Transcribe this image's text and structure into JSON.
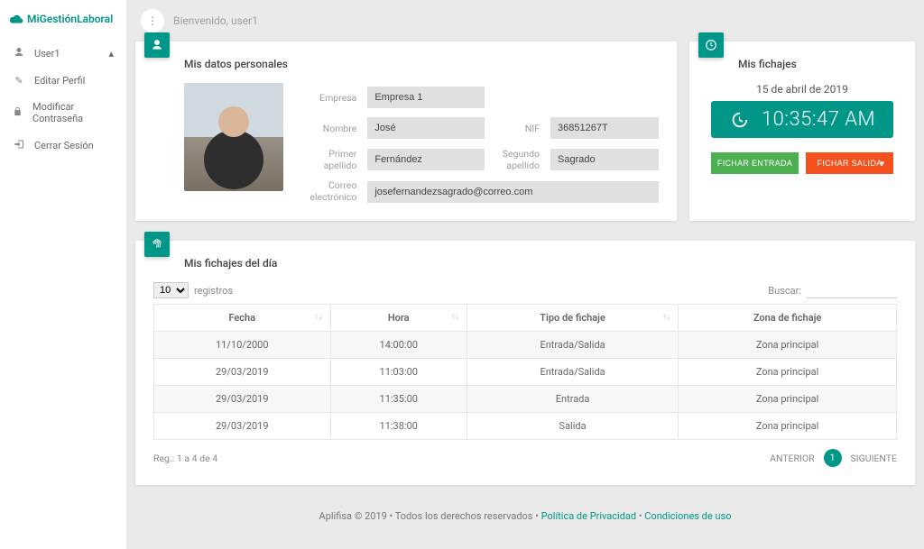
{
  "brand": "MiGestiónLaboral",
  "topbar": {
    "welcome": "Bienvenido, user1"
  },
  "sidebar": {
    "user": "User1",
    "items": [
      {
        "icon": "pencil-icon",
        "label": "Editar Perfil"
      },
      {
        "icon": "lock-icon",
        "label": "Modificar Contraseña"
      },
      {
        "icon": "logout-icon",
        "label": "Cerrar Sesión"
      }
    ]
  },
  "personal": {
    "title": "Mis datos personales",
    "labels": {
      "empresa": "Empresa",
      "nombre": "Nombre",
      "nif": "NIF",
      "apellido1": "Primer apellido",
      "apellido2": "Segundo apellido",
      "correo": "Correo electrónico"
    },
    "values": {
      "empresa": "Empresa 1",
      "nombre": "José",
      "nif": "36851267T",
      "apellido1": "Fernández",
      "apellido2": "Sagrado",
      "correo": "josefernandezsagrado@correo.com"
    }
  },
  "clock": {
    "title": "Mis fichajes",
    "date": "15 de abril de 2019",
    "time": "10:35:47 AM",
    "btn_in": "FICHAR ENTRADA",
    "btn_out": "FICHAR SALIDA"
  },
  "daylog": {
    "title": "Mis fichajes del día",
    "page_size": "10",
    "page_size_label": "registros",
    "search_label": "Buscar:",
    "columns": [
      "Fecha",
      "Hora",
      "Tipo de fichaje",
      "Zona de fichaje"
    ],
    "rows": [
      {
        "fecha": "11/10/2000",
        "hora": "14:00:00",
        "tipo": "Entrada/Salida",
        "zona": "Zona principal"
      },
      {
        "fecha": "29/03/2019",
        "hora": "11:03:00",
        "tipo": "Entrada/Salida",
        "zona": "Zona principal"
      },
      {
        "fecha": "29/03/2019",
        "hora": "11:35:00",
        "tipo": "Entrada",
        "zona": "Zona principal"
      },
      {
        "fecha": "29/03/2019",
        "hora": "11:38:00",
        "tipo": "Salida",
        "zona": "Zona principal"
      }
    ],
    "summary": "Reg.: 1 a 4 de 4",
    "prev": "ANTERIOR",
    "next": "SIGUIENTE",
    "page": "1"
  },
  "footer": {
    "text1": "Aplifisa © 2019 • Todos los derechos reservados • ",
    "link1": "Política de Privacidad",
    "sep": " • ",
    "link2": "Condiciones de uso"
  }
}
